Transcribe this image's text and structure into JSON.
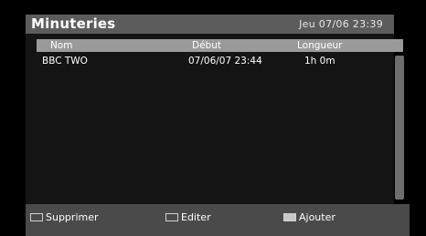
{
  "header": {
    "title": "Minuteries",
    "datetime": "Jeu 07/06 23:39"
  },
  "table": {
    "columns": [
      "Nom",
      "Début",
      "Longueur"
    ],
    "rows": [
      {
        "nom": "BBC TWO",
        "debut": "07/06/07  23:44",
        "longueur": "1h 0m"
      }
    ]
  },
  "footer": {
    "items": [
      {
        "label": "Supprimer",
        "color": "#4a4a4a"
      },
      {
        "label": "Editer",
        "color": "#4a4a4a"
      },
      {
        "label": "Ajouter",
        "color": "#c8c8c8"
      }
    ]
  },
  "colors": {
    "background": "#000000",
    "title_bar": "#5c5c5c",
    "header_row": "#9a9a9a",
    "footer_bar": "#4a4a4a"
  }
}
